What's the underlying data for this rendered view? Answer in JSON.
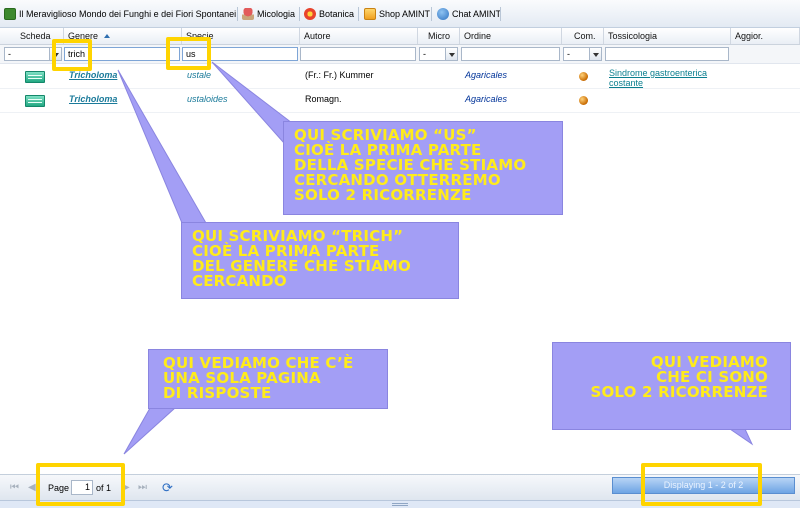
{
  "toolbar": {
    "items": [
      {
        "label": "Il Meraviglioso Mondo dei Funghi e dei Fiori Spontanei",
        "icon": "app-logo-icon"
      },
      {
        "label": "Micologia",
        "icon": "mushroom-icon"
      },
      {
        "label": "Botanica",
        "icon": "flower-icon"
      },
      {
        "label": "Shop AMINT",
        "icon": "shop-icon"
      },
      {
        "label": "Chat AMINT",
        "icon": "chat-icon"
      }
    ]
  },
  "grid": {
    "columns": [
      "Scheda",
      "Genere",
      "Specie",
      "Autore",
      "Micro",
      "Ordine",
      "Com.",
      "Tossicologia",
      "Aggior."
    ],
    "filters": {
      "scheda": "-",
      "genere": "trich",
      "specie": "us",
      "autore": "",
      "micro": "-",
      "ordine": "",
      "com": "-",
      "tossicologia": ""
    },
    "rows": [
      {
        "genere": "Tricholoma",
        "specie": "ustale",
        "autore": "(Fr.: Fr.) Kummer",
        "ordine": "Agaricales",
        "toss_line1": "Sindrome gastroenterica",
        "toss_line2": "costante"
      },
      {
        "genere": "Tricholoma",
        "specie": "ustaloides",
        "autore": "Romagn.",
        "ordine": "Agaricales",
        "toss_line1": "",
        "toss_line2": ""
      }
    ]
  },
  "pager": {
    "page_label": "Page",
    "page_value": "1",
    "of_label": "of 1",
    "displaying": "Displaying 1 - 2 of 2"
  },
  "annotations": {
    "specie_note": "QUI SCRIVIAMO “us”\nCIOÈ LA PRIMA PARTE\nDELLA SPECIE CHE STIAMO\nCERCANDO OTTERREMO\nSOLO 2 RICORRENZE",
    "genere_note": "QUI SCRIVIAMO “trich”\nCIOÈ LA PRIMA PARTE\nDEL GENERE CHE STIAMO\nCERCANDO",
    "pages_note": "QUI VEDIAMO CHE C’È\nUNA SOLA PAGINA\nDI RISPOSTE",
    "count_note": "QUI VEDIAMO\nCHE CI SONO\nSOLO 2 RICORRENZE"
  },
  "colors": {
    "callout_bg": "#a39ef5",
    "callout_text": "#ffec1a",
    "highlight": "#ffd400"
  }
}
